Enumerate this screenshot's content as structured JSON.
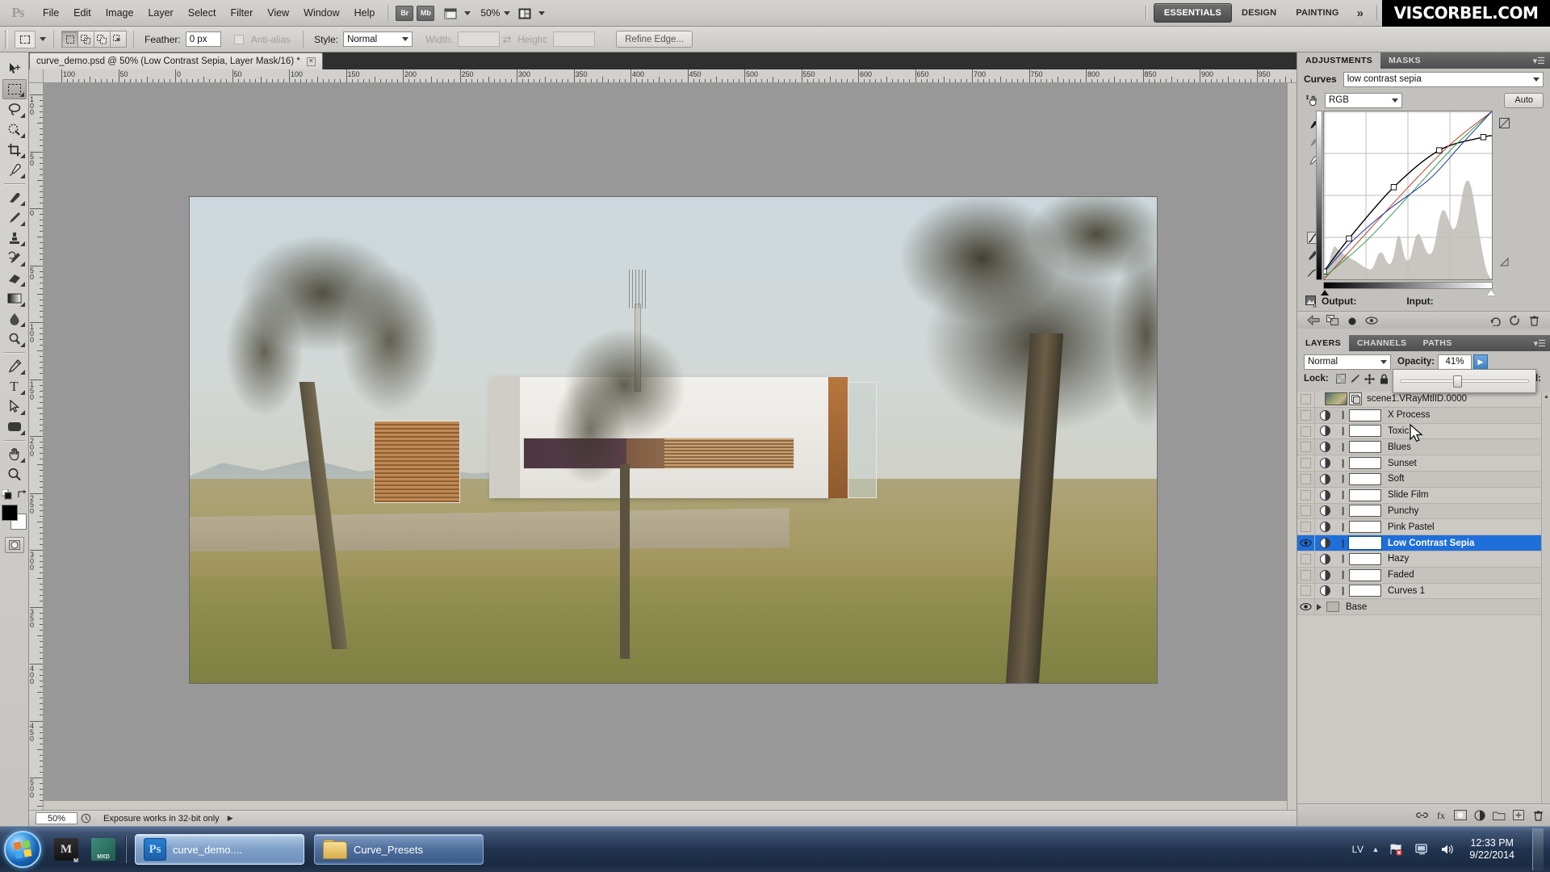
{
  "app": {
    "name": "Adobe Photoshop",
    "logo_text": "Ps"
  },
  "menubar": {
    "items": [
      "File",
      "Edit",
      "Image",
      "Layer",
      "Select",
      "Filter",
      "View",
      "Window",
      "Help"
    ],
    "bridge_label": "Br",
    "minibridge_label": "Mb",
    "zoom_level": "50%",
    "workspaces": [
      "ESSENTIALS",
      "DESIGN",
      "PAINTING"
    ],
    "workspace_active": "ESSENTIALS",
    "more_glyph": "»",
    "brand": "VISCORBEL.COM"
  },
  "options_bar": {
    "feather_label": "Feather:",
    "feather_value": "0 px",
    "antialias_label": "Anti-alias",
    "style_label": "Style:",
    "style_value": "Normal",
    "width_label": "Width:",
    "width_value": "",
    "height_label": "Height:",
    "height_value": "",
    "refine_edge_label": "Refine Edge..."
  },
  "document": {
    "tab_title": "curve_demo.psd @ 50% (Low Contrast Sepia, Layer Mask/16) *",
    "close_glyph": "✕"
  },
  "rulers": {
    "unit": "mm",
    "h_labels": [
      "100",
      "50",
      "0",
      "50",
      "100",
      "150",
      "200",
      "250",
      "300",
      "350",
      "400",
      "450",
      "500",
      "550",
      "600",
      "650",
      "700",
      "750",
      "800",
      "850",
      "900",
      "950"
    ],
    "v_labels": [
      "100",
      "50",
      "0",
      "50",
      "100",
      "150",
      "200",
      "250",
      "300",
      "350",
      "400",
      "450",
      "500"
    ]
  },
  "statusbar": {
    "zoom": "50%",
    "message": "Exposure works in 32-bit only"
  },
  "toolbar": {
    "tools": [
      {
        "name": "move-tool",
        "glyph": "↖"
      },
      {
        "name": "rectangular-marquee-tool",
        "glyph": "⬚"
      },
      {
        "name": "lasso-tool",
        "glyph": "❀"
      },
      {
        "name": "quick-selection-tool",
        "glyph": "◌"
      },
      {
        "name": "crop-tool",
        "glyph": "⌗"
      },
      {
        "name": "eyedropper-tool",
        "glyph": "✒"
      },
      {
        "name": "spot-healing-brush-tool",
        "glyph": "✑"
      },
      {
        "name": "brush-tool",
        "glyph": "✎"
      },
      {
        "name": "clone-stamp-tool",
        "glyph": "⚓"
      },
      {
        "name": "history-brush-tool",
        "glyph": "✐"
      },
      {
        "name": "eraser-tool",
        "glyph": "▱"
      },
      {
        "name": "gradient-tool",
        "glyph": "■"
      },
      {
        "name": "blur-tool",
        "glyph": "●"
      },
      {
        "name": "dodge-tool",
        "glyph": "◔"
      },
      {
        "name": "pen-tool",
        "glyph": "✒"
      },
      {
        "name": "type-tool",
        "glyph": "T"
      },
      {
        "name": "path-selection-tool",
        "glyph": "➤"
      },
      {
        "name": "rectangle-tool",
        "glyph": "▭"
      },
      {
        "name": "hand-tool",
        "glyph": "✋"
      },
      {
        "name": "zoom-tool",
        "glyph": "⚲"
      }
    ],
    "selected_tool": "rectangular-marquee-tool",
    "foreground_color": "#000000",
    "background_color": "#ffffff"
  },
  "adjustments_panel": {
    "tabs": [
      "ADJUSTMENTS",
      "MASKS"
    ],
    "active_tab": "ADJUSTMENTS",
    "title": "Curves",
    "preset_value": "low contrast sepia",
    "channel_value": "RGB",
    "auto_label": "Auto",
    "output_label": "Output:",
    "input_label": "Input:",
    "output_value": "",
    "input_value": ""
  },
  "chart_data": {
    "type": "line",
    "title": "Curves — low contrast sepia",
    "xlabel": "Input",
    "ylabel": "Output",
    "xlim": [
      0,
      255
    ],
    "ylim": [
      0,
      255
    ],
    "grid": true,
    "legend": "none",
    "series": [
      {
        "name": "RGB composite",
        "color": "#000000",
        "points": [
          [
            0,
            12
          ],
          [
            38,
            62
          ],
          [
            106,
            140
          ],
          [
            175,
            196
          ],
          [
            242,
            216
          ],
          [
            255,
            218
          ]
        ]
      },
      {
        "name": "Red channel",
        "color": "#c23b22",
        "points": [
          [
            0,
            0
          ],
          [
            64,
            70
          ],
          [
            128,
            140
          ],
          [
            192,
            205
          ],
          [
            255,
            255
          ]
        ]
      },
      {
        "name": "Green channel",
        "color": "#2e9e49",
        "points": [
          [
            0,
            3
          ],
          [
            64,
            58
          ],
          [
            128,
            126
          ],
          [
            192,
            196
          ],
          [
            255,
            255
          ]
        ]
      },
      {
        "name": "Blue channel",
        "color": "#2030a8",
        "points": [
          [
            0,
            10
          ],
          [
            40,
            55
          ],
          [
            96,
            104
          ],
          [
            160,
            152
          ],
          [
            208,
            204
          ],
          [
            255,
            255
          ]
        ]
      }
    ],
    "control_points": [
      [
        0,
        12
      ],
      [
        38,
        62
      ],
      [
        106,
        140
      ],
      [
        175,
        196
      ],
      [
        242,
        216
      ]
    ],
    "histogram": [
      2,
      3,
      4,
      6,
      9,
      14,
      22,
      30,
      38,
      46,
      52,
      58,
      62,
      66,
      70,
      72,
      74,
      73,
      71,
      70,
      68,
      67,
      66,
      64,
      63,
      62,
      61,
      60,
      58,
      57,
      56,
      55,
      54,
      53,
      52,
      52,
      51,
      50,
      49,
      48,
      47,
      46,
      45,
      44,
      43,
      43,
      42,
      41,
      40,
      39,
      38,
      37,
      36,
      35,
      34,
      33,
      32,
      31,
      30,
      29,
      28,
      27,
      26,
      25,
      25,
      24,
      24,
      23,
      23,
      22,
      22,
      23,
      24,
      26,
      28,
      31,
      34,
      38,
      42,
      46,
      50,
      53,
      56,
      58,
      59,
      60,
      60,
      59,
      58,
      56,
      53,
      50,
      46,
      43,
      40,
      38,
      36,
      35,
      34,
      34,
      35,
      37,
      40,
      44,
      49,
      55,
      62,
      70,
      78,
      86,
      92,
      96,
      98,
      97,
      94,
      89,
      83,
      76,
      69,
      62,
      56,
      51,
      47,
      44,
      42,
      41,
      41,
      42,
      44,
      47,
      51,
      56,
      62,
      68,
      74,
      80,
      86,
      91,
      95,
      98,
      100,
      101,
      101,
      100,
      98,
      95,
      92,
      88,
      84,
      80,
      76,
      72,
      68,
      65,
      62,
      60,
      58,
      57,
      56,
      56,
      57,
      58,
      60,
      63,
      67,
      72,
      78,
      85,
      93,
      101,
      110,
      118,
      126,
      133,
      139,
      144,
      148,
      151,
      153,
      154,
      154,
      153,
      151,
      148,
      145,
      141,
      137,
      133,
      129,
      125,
      121,
      118,
      115,
      113,
      112,
      112,
      113,
      115,
      118,
      122,
      127,
      133,
      140,
      148,
      157,
      166,
      175,
      184,
      192,
      199,
      205,
      210,
      214,
      217,
      219,
      220,
      220,
      219,
      217,
      214,
      210,
      205,
      199,
      192,
      184,
      175,
      166,
      157,
      148,
      139,
      130,
      121,
      112,
      103,
      94,
      85,
      76,
      68,
      60,
      52,
      45,
      38,
      32,
      26,
      21,
      17,
      13,
      10,
      7,
      5,
      3,
      2,
      1
    ]
  },
  "layers_panel": {
    "tabs": [
      "LAYERS",
      "CHANNELS",
      "PATHS"
    ],
    "active_tab": "LAYERS",
    "blend_mode": "Normal",
    "opacity_label": "Opacity:",
    "opacity_value": "41%",
    "lock_label": "Lock:",
    "fill_label": "Fill:",
    "fill_value": "",
    "layers": [
      {
        "name": "scene1.VRayMtlID.0000",
        "type": "smart-object",
        "visible": false,
        "selected": false
      },
      {
        "name": "X Process",
        "type": "adjustment",
        "visible": false,
        "selected": false
      },
      {
        "name": "Toxic",
        "type": "adjustment",
        "visible": false,
        "selected": false
      },
      {
        "name": "Blues",
        "type": "adjustment",
        "visible": false,
        "selected": false
      },
      {
        "name": "Sunset",
        "type": "adjustment",
        "visible": false,
        "selected": false
      },
      {
        "name": "Soft",
        "type": "adjustment",
        "visible": false,
        "selected": false
      },
      {
        "name": "Slide Film",
        "type": "adjustment",
        "visible": false,
        "selected": false
      },
      {
        "name": "Punchy",
        "type": "adjustment",
        "visible": false,
        "selected": false
      },
      {
        "name": "Pink Pastel",
        "type": "adjustment",
        "visible": false,
        "selected": false
      },
      {
        "name": "Low Contrast Sepia",
        "type": "adjustment",
        "visible": true,
        "selected": true
      },
      {
        "name": "Hazy",
        "type": "adjustment",
        "visible": false,
        "selected": false
      },
      {
        "name": "Faded",
        "type": "adjustment",
        "visible": false,
        "selected": false
      },
      {
        "name": "Curves 1",
        "type": "adjustment",
        "visible": false,
        "selected": false
      },
      {
        "name": "Base",
        "type": "group",
        "visible": true,
        "selected": false
      }
    ]
  },
  "taskbar": {
    "start_tooltip": "Start",
    "quick_launch": [
      "maya-icon",
      "mxd-icon"
    ],
    "windows": [
      {
        "label": "curve_demo....",
        "icon": "photoshop-icon",
        "active": true
      },
      {
        "label": "Curve_Presets",
        "icon": "folder-icon",
        "active": false
      }
    ],
    "tray": {
      "language": "LV",
      "icons": [
        "network-error-icon",
        "display-icon",
        "volume-icon"
      ],
      "time": "12:33 PM",
      "date": "9/22/2014"
    }
  }
}
